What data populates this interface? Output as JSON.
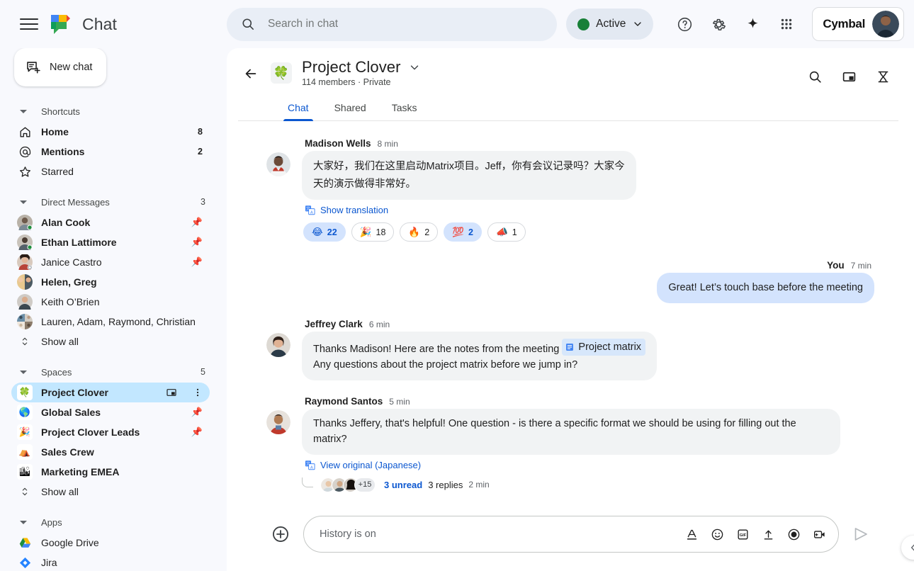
{
  "topbar": {
    "menu_icon": "hamburger-icon",
    "product_logo": "google-chat-logo",
    "product_name": "Chat",
    "search": {
      "placeholder": "Search in chat",
      "value": "",
      "icon": "search-icon"
    },
    "status": {
      "label": "Active",
      "color": "#188038",
      "chevron": "chevron-down-icon"
    },
    "help_icon": "help-circle-icon",
    "settings_icon": "gear-icon",
    "gemini_icon": "sparkle-icon",
    "apps_icon": "apps-grid-icon",
    "account": {
      "org": "Cymbal",
      "avatar": "user-avatar"
    }
  },
  "sidebar": {
    "new_chat": {
      "label": "New chat",
      "icon": "new-chat-icon"
    },
    "sections": [
      {
        "title": "Shortcuts",
        "count": "",
        "items": [
          {
            "label": "Home",
            "icon": "home-icon",
            "badge": "8",
            "bold": true
          },
          {
            "label": "Mentions",
            "icon": "at-icon",
            "badge": "2",
            "bold": true
          },
          {
            "label": "Starred",
            "icon": "star-icon",
            "badge": "",
            "bold": false
          }
        ]
      },
      {
        "title": "Direct Messages",
        "count": "3",
        "items": [
          {
            "label": "Alan Cook",
            "icon": "avatar",
            "pinned": true,
            "bold": true,
            "presence": "active"
          },
          {
            "label": "Ethan Lattimore",
            "icon": "avatar",
            "pinned": true,
            "bold": true,
            "presence": "active"
          },
          {
            "label": "Janice Castro",
            "icon": "avatar",
            "pinned": true,
            "bold": false,
            "presence": "away"
          },
          {
            "label": "Helen, Greg",
            "icon": "avatar",
            "pinned": false,
            "bold": true,
            "presence": ""
          },
          {
            "label": "Keith O’Brien",
            "icon": "avatar",
            "pinned": false,
            "bold": false,
            "presence": ""
          },
          {
            "label": "Lauren, Adam, Raymond, Christian",
            "icon": "avatar",
            "pinned": false,
            "bold": false,
            "presence": ""
          }
        ],
        "show_all": "Show all"
      },
      {
        "title": "Spaces",
        "count": "5",
        "items": [
          {
            "label": "Project Clover",
            "emoji": "🍀",
            "selected": true,
            "bold": true,
            "trailing": [
              "pip-icon",
              "more-vert-icon"
            ]
          },
          {
            "label": "Global Sales",
            "emoji": "🌎",
            "selected": false,
            "bold": true,
            "pinned": true
          },
          {
            "label": "Project Clover Leads",
            "emoji": "🎉",
            "selected": false,
            "bold": true,
            "pinned": true
          },
          {
            "label": "Sales Crew",
            "emoji": "⛺",
            "selected": false,
            "bold": true
          },
          {
            "label": "Marketing EMEA",
            "emoji": "🏙",
            "selected": false,
            "bold": true
          }
        ],
        "show_all": "Show all"
      },
      {
        "title": "Apps",
        "count": "",
        "items": [
          {
            "label": "Google Drive",
            "icon": "google-drive-icon",
            "bold": false
          },
          {
            "label": "Jira",
            "icon": "jira-icon",
            "bold": false
          }
        ]
      }
    ]
  },
  "conversation": {
    "back_icon": "back-arrow-icon",
    "emoji": "🍀",
    "title": "Project Clover",
    "title_chevron": "chevron-down-icon",
    "subtitle": "114 members · Private",
    "actions": [
      "search-icon",
      "picture-in-picture-icon",
      "thread-spool-icon"
    ],
    "tabs": [
      {
        "label": "Chat",
        "active": true
      },
      {
        "label": "Shared",
        "active": false
      },
      {
        "label": "Tasks",
        "active": false
      }
    ]
  },
  "messages": [
    {
      "author": "Madison Wells",
      "time": "8 min",
      "text": "大家好，我们在这里启动Matrix项目。Jeff，你有会议记录吗？大家今天的演示做得非常好。",
      "outgoing": false,
      "translate": {
        "label": "Show translation",
        "icon": "translate-icon"
      },
      "reactions": [
        {
          "emoji": "😂",
          "count": "22",
          "selected": true
        },
        {
          "emoji": "🎉",
          "count": "18",
          "selected": false
        },
        {
          "emoji": "🔥",
          "count": "2",
          "selected": false
        },
        {
          "emoji": "💯",
          "count": "2",
          "selected": true
        },
        {
          "emoji": "📣",
          "count": "1",
          "selected": false
        }
      ]
    },
    {
      "author": "You",
      "time": "7 min",
      "text": "Great! Let’s touch base before the meeting",
      "outgoing": true
    },
    {
      "author": "Jeffrey Clark",
      "time": "6 min",
      "text_before": "Thanks Madison!  Here are the notes from the meeting ",
      "chip": {
        "label": "Project matrix",
        "icon": "doc-icon"
      },
      "text_after": "Any questions about the project matrix before we jump in?",
      "outgoing": false
    },
    {
      "author": "Raymond Santos",
      "time": "5 min",
      "text": "Thanks Jeffery, that's helpful!  One question -  is there a specific format we should be using for filling out the matrix?",
      "outgoing": false,
      "translate": {
        "label": "View original (Japanese)",
        "icon": "translate-icon"
      },
      "thread": {
        "overflow": "+15",
        "unread": "3 unread",
        "replies": "3 replies",
        "time": "2 min"
      }
    }
  ],
  "composer": {
    "plus_icon": "add-circle-icon",
    "placeholder": "History is on",
    "value": "",
    "icons": [
      "format-text-icon",
      "emoji-icon",
      "gif-icon",
      "upload-icon",
      "record-icon",
      "video-icon"
    ],
    "send_icon": "send-icon"
  },
  "edge": {
    "collapse_icon": "chevron-left-icon"
  }
}
